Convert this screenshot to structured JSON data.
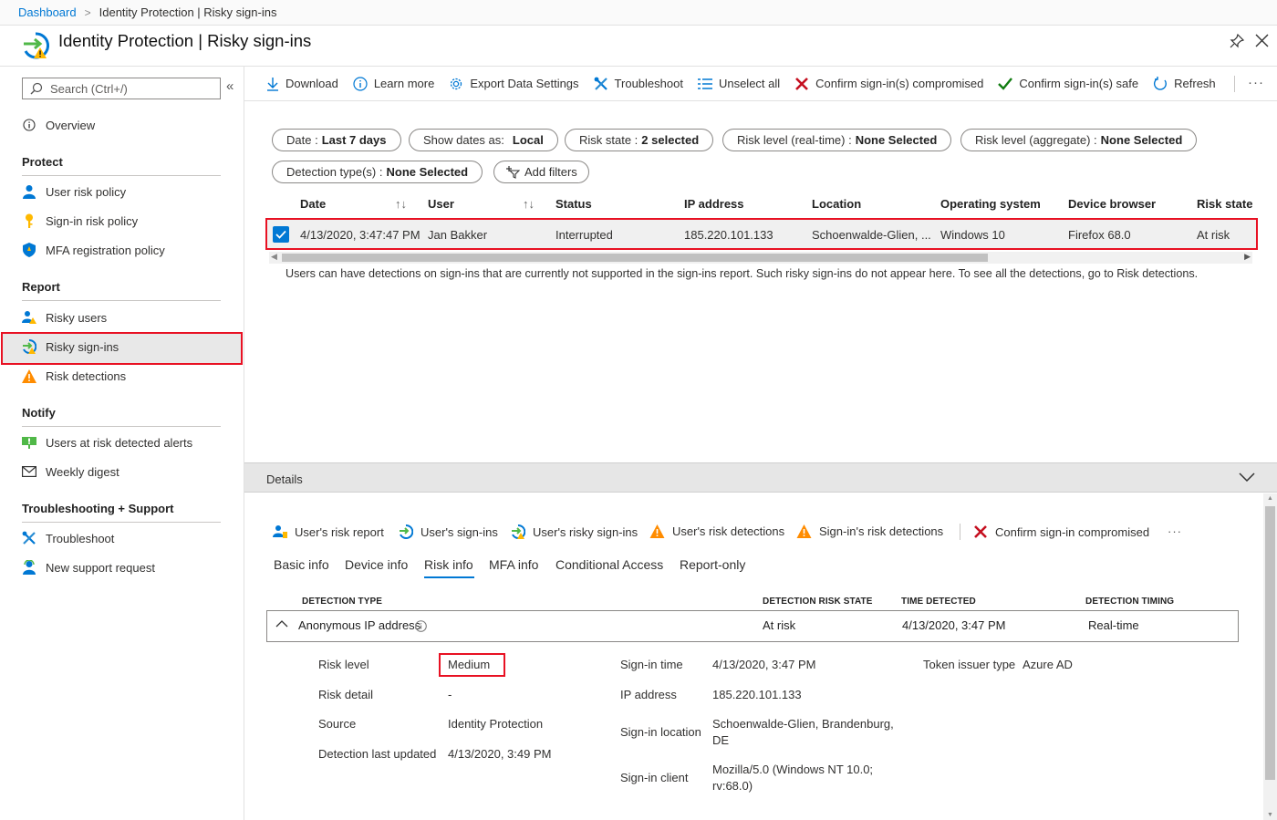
{
  "breadcrumb": {
    "root": "Dashboard",
    "current": "Identity Protection | Risky sign-ins"
  },
  "header": {
    "title": "Identity Protection | Risky sign-ins"
  },
  "sidebar": {
    "search_placeholder": "Search (Ctrl+/)",
    "overview": "Overview",
    "sections": {
      "protect": "Protect",
      "report": "Report",
      "notify": "Notify",
      "support": "Troubleshooting + Support"
    },
    "protect_items": [
      "User risk policy",
      "Sign-in risk policy",
      "MFA registration policy"
    ],
    "report_items": [
      "Risky users",
      "Risky sign-ins",
      "Risk detections"
    ],
    "notify_items": [
      "Users at risk detected alerts",
      "Weekly digest"
    ],
    "support_items": [
      "Troubleshoot",
      "New support request"
    ],
    "selected": "Risky sign-ins"
  },
  "toolbar": {
    "download": "Download",
    "learn_more": "Learn more",
    "export": "Export Data Settings",
    "troubleshoot": "Troubleshoot",
    "unselect": "Unselect all",
    "confirm_compromised": "Confirm sign-in(s) compromised",
    "confirm_safe": "Confirm sign-in(s) safe",
    "refresh": "Refresh",
    "more": "···"
  },
  "filters": {
    "date_label": "Date :",
    "date_value": "Last 7 days",
    "show_dates_label": "Show dates as:",
    "show_dates_value": "Local",
    "risk_state_label": "Risk state :",
    "risk_state_value": "2 selected",
    "risk_rt_label": "Risk level (real-time) :",
    "risk_rt_value": "None Selected",
    "risk_agg_label": "Risk level (aggregate) :",
    "risk_agg_value": "None Selected",
    "detection_label": "Detection type(s) :",
    "detection_value": "None Selected",
    "add_filters": "Add filters"
  },
  "grid": {
    "columns": [
      "Date",
      "User",
      "Status",
      "IP address",
      "Location",
      "Operating system",
      "Device browser",
      "Risk state"
    ],
    "rows": [
      {
        "date": "4/13/2020, 3:47:47 PM",
        "user": "Jan Bakker",
        "status": "Interrupted",
        "ip": "185.220.101.133",
        "location": "Schoenwalde-Glien, ...",
        "os": "Windows 10",
        "browser": "Firefox 68.0",
        "risk_state": "At risk",
        "selected": true
      }
    ],
    "note": "Users can have detections on sign-ins that are currently not supported in the sign-ins report. Such risky sign-ins do not appear here. To see all the detections, go to Risk detections."
  },
  "details": {
    "title": "Details",
    "commands": [
      "User's risk report",
      "User's sign-ins",
      "User's risky sign-ins",
      "User's risk detections",
      "Sign-in's risk detections",
      "Confirm sign-in compromised"
    ],
    "more": "···",
    "tabs": [
      "Basic info",
      "Device info",
      "Risk info",
      "MFA info",
      "Conditional Access",
      "Report-only"
    ],
    "active_tab": "Risk info",
    "table_headers": [
      "DETECTION TYPE",
      "DETECTION RISK STATE",
      "TIME DETECTED",
      "DETECTION TIMING"
    ],
    "detection": {
      "type": "Anonymous IP address",
      "state": "At risk",
      "time": "4/13/2020, 3:47 PM",
      "timing": "Real-time"
    },
    "fields": {
      "risk_level_k": "Risk level",
      "risk_level_v": "Medium",
      "risk_detail_k": "Risk detail",
      "risk_detail_v": "-",
      "source_k": "Source",
      "source_v": "Identity Protection",
      "last_updated_k": "Detection last updated",
      "last_updated_v": "4/13/2020, 3:49 PM",
      "signin_time_k": "Sign-in time",
      "signin_time_v": "4/13/2020, 3:47 PM",
      "ip_k": "IP address",
      "ip_v": "185.220.101.133",
      "location_k": "Sign-in location",
      "location_v1": "Schoenwalde-Glien, Brandenburg,",
      "location_v2": "DE",
      "client_k": "Sign-in client",
      "client_v1": "Mozilla/5.0 (Windows NT 10.0;",
      "client_v2": "rv:68.0)",
      "token_k": "Token issuer type",
      "token_v": "Azure AD"
    }
  },
  "colors": {
    "accent": "#0078d4",
    "highlight": "#e81123",
    "warning": "#ff8c00",
    "success": "#107c10"
  }
}
